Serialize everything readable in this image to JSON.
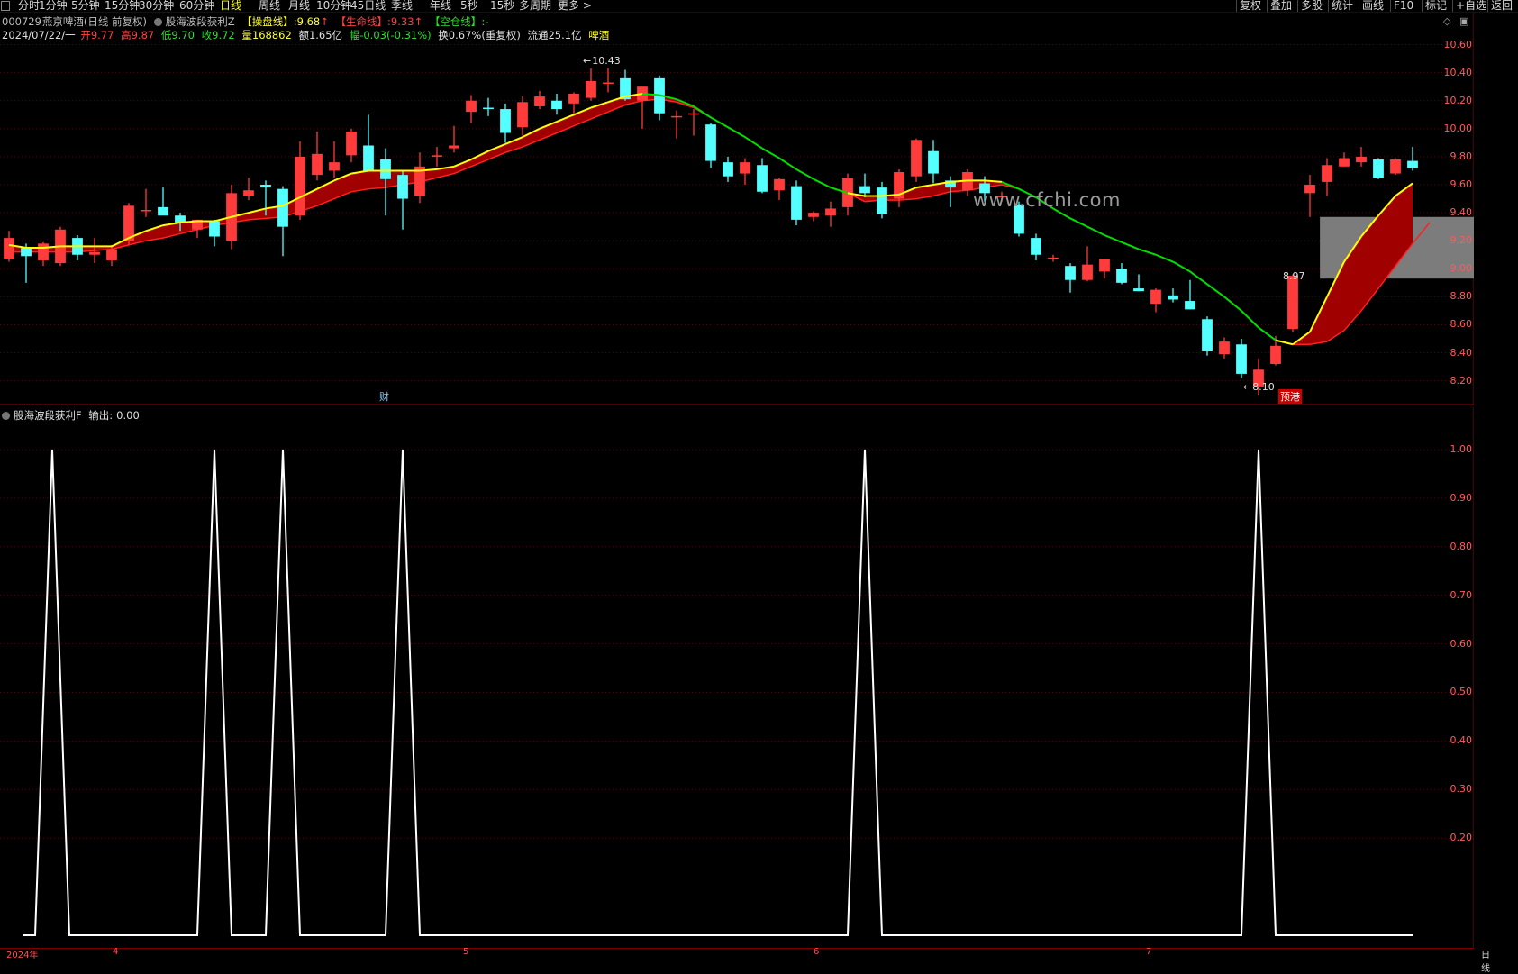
{
  "toolbar": {
    "timeframes": [
      "分时",
      "1分钟",
      "5分钟",
      "15分钟",
      "30分钟",
      "60分钟",
      "日线",
      "周线",
      "月线",
      "10分钟",
      "45日线",
      "季线",
      "年线",
      "5秒",
      "15秒",
      "多周期",
      "更多 >"
    ],
    "active_timeframe": "日线",
    "right_buttons": [
      "复权",
      "叠加",
      "多股",
      "统计",
      "画线",
      "F10",
      "标记",
      "+自选",
      "返回"
    ]
  },
  "main": {
    "stock_code": "000729",
    "stock_name": "燕京啤酒",
    "stock_mode": "(日线 前复权)",
    "indicator_name": "股海波段获利Z",
    "line1_label": "【操盘线】",
    "line1_value": "9.68",
    "line2_label": "【生命线】",
    "line2_value": "9.33",
    "line3_label": "【空仓线】",
    "line3_value": "-",
    "date": "2024/07/22/一",
    "open_label": "开",
    "open": "9.77",
    "high_label": "高",
    "high": "9.87",
    "low_label": "低",
    "low": "9.70",
    "close_label": "收",
    "close": "9.72",
    "vol_label": "量",
    "vol": "168862",
    "amount_label": "额",
    "amount": "1.65亿",
    "chg_label": "幅",
    "chg": "-0.03(-0.31%)",
    "turnover_label": "换",
    "turnover": "0.67%(重复权)",
    "float_label": "流通",
    "float": "25.1亿",
    "sector": "啤酒",
    "max_marker": "10.43",
    "min_marker": "8.10",
    "box_label": "8.97",
    "event_cai": "财",
    "event_yugang": "预港",
    "watermark": "www.cfchi.com",
    "y_ticks": [
      "10.60",
      "10.40",
      "10.20",
      "10.00",
      "9.80",
      "9.60",
      "9.40",
      "9.20",
      "9.00",
      "8.80",
      "8.60",
      "8.40",
      "8.20"
    ]
  },
  "sub": {
    "indicator_name": "股海波段获利F",
    "output_label": "输出:",
    "output_value": "0.00",
    "y_ticks": [
      "1.00",
      "0.90",
      "0.80",
      "0.70",
      "0.60",
      "0.50",
      "0.40",
      "0.30",
      "0.20"
    ]
  },
  "x_axis": {
    "labels": [
      "2024年",
      "4",
      "5",
      "6",
      "7"
    ],
    "right_label": "日线"
  },
  "colors": {
    "up": "#ff3b3b",
    "down": "#54ffff",
    "ma_up": "#ffff00",
    "ma_down": "#00dd00",
    "ribbon": "#a00000",
    "grid": "#5a0000"
  },
  "chart_data": {
    "type": "candlestick",
    "price_ylim": [
      8.05,
      10.7
    ],
    "candles": [
      {
        "o": 9.07,
        "h": 9.27,
        "l": 9.05,
        "c": 9.22
      },
      {
        "o": 9.15,
        "h": 9.18,
        "l": 8.9,
        "c": 9.09
      },
      {
        "o": 9.06,
        "h": 9.19,
        "l": 9.02,
        "c": 9.18
      },
      {
        "o": 9.04,
        "h": 9.3,
        "l": 9.02,
        "c": 9.28
      },
      {
        "o": 9.22,
        "h": 9.24,
        "l": 9.06,
        "c": 9.1
      },
      {
        "o": 9.1,
        "h": 9.22,
        "l": 9.04,
        "c": 9.12
      },
      {
        "o": 9.06,
        "h": 9.17,
        "l": 9.02,
        "c": 9.14
      },
      {
        "o": 9.2,
        "h": 9.47,
        "l": 9.17,
        "c": 9.45
      },
      {
        "o": 9.42,
        "h": 9.57,
        "l": 9.37,
        "c": 9.42
      },
      {
        "o": 9.44,
        "h": 9.58,
        "l": 9.39,
        "c": 9.38
      },
      {
        "o": 9.38,
        "h": 9.4,
        "l": 9.27,
        "c": 9.33
      },
      {
        "o": 9.28,
        "h": 9.35,
        "l": 9.22,
        "c": 9.35
      },
      {
        "o": 9.34,
        "h": 9.35,
        "l": 9.16,
        "c": 9.23
      },
      {
        "o": 9.2,
        "h": 9.6,
        "l": 9.14,
        "c": 9.54
      },
      {
        "o": 9.52,
        "h": 9.65,
        "l": 9.49,
        "c": 9.56
      },
      {
        "o": 9.6,
        "h": 9.63,
        "l": 9.38,
        "c": 9.58
      },
      {
        "o": 9.57,
        "h": 9.59,
        "l": 9.09,
        "c": 9.3
      },
      {
        "o": 9.38,
        "h": 9.91,
        "l": 9.35,
        "c": 9.8
      },
      {
        "o": 9.67,
        "h": 9.98,
        "l": 9.63,
        "c": 9.82
      },
      {
        "o": 9.7,
        "h": 9.91,
        "l": 9.65,
        "c": 9.76
      },
      {
        "o": 9.81,
        "h": 10.0,
        "l": 9.76,
        "c": 9.98
      },
      {
        "o": 9.88,
        "h": 10.1,
        "l": 9.71,
        "c": 9.7
      },
      {
        "o": 9.78,
        "h": 9.86,
        "l": 9.38,
        "c": 9.64
      },
      {
        "o": 9.67,
        "h": 9.7,
        "l": 9.28,
        "c": 9.5
      },
      {
        "o": 9.52,
        "h": 9.83,
        "l": 9.47,
        "c": 9.73
      },
      {
        "o": 9.8,
        "h": 9.87,
        "l": 9.73,
        "c": 9.81
      },
      {
        "o": 9.86,
        "h": 10.02,
        "l": 9.83,
        "c": 9.88
      },
      {
        "o": 10.12,
        "h": 10.24,
        "l": 10.04,
        "c": 10.2
      },
      {
        "o": 10.15,
        "h": 10.22,
        "l": 10.09,
        "c": 10.14
      },
      {
        "o": 10.14,
        "h": 10.18,
        "l": 9.9,
        "c": 9.97
      },
      {
        "o": 10.01,
        "h": 10.23,
        "l": 9.95,
        "c": 10.19
      },
      {
        "o": 10.16,
        "h": 10.27,
        "l": 10.14,
        "c": 10.23
      },
      {
        "o": 10.2,
        "h": 10.25,
        "l": 10.1,
        "c": 10.14
      },
      {
        "o": 10.18,
        "h": 10.26,
        "l": 10.09,
        "c": 10.25
      },
      {
        "o": 10.22,
        "h": 10.43,
        "l": 10.2,
        "c": 10.34
      },
      {
        "o": 10.33,
        "h": 10.43,
        "l": 10.26,
        "c": 10.33
      },
      {
        "o": 10.36,
        "h": 10.42,
        "l": 10.2,
        "c": 10.21
      },
      {
        "o": 10.2,
        "h": 10.3,
        "l": 10.0,
        "c": 10.3
      },
      {
        "o": 10.36,
        "h": 10.38,
        "l": 10.06,
        "c": 10.11
      },
      {
        "o": 10.09,
        "h": 10.13,
        "l": 9.93,
        "c": 10.09
      },
      {
        "o": 10.11,
        "h": 10.14,
        "l": 9.95,
        "c": 10.11
      },
      {
        "o": 10.03,
        "h": 10.04,
        "l": 9.72,
        "c": 9.77
      },
      {
        "o": 9.76,
        "h": 9.8,
        "l": 9.62,
        "c": 9.66
      },
      {
        "o": 9.68,
        "h": 9.79,
        "l": 9.6,
        "c": 9.76
      },
      {
        "o": 9.74,
        "h": 9.79,
        "l": 9.54,
        "c": 9.55
      },
      {
        "o": 9.56,
        "h": 9.65,
        "l": 9.49,
        "c": 9.64
      },
      {
        "o": 9.59,
        "h": 9.63,
        "l": 9.31,
        "c": 9.35
      },
      {
        "o": 9.37,
        "h": 9.41,
        "l": 9.34,
        "c": 9.4
      },
      {
        "o": 9.38,
        "h": 9.48,
        "l": 9.3,
        "c": 9.43
      },
      {
        "o": 9.44,
        "h": 9.68,
        "l": 9.38,
        "c": 9.65
      },
      {
        "o": 9.59,
        "h": 9.68,
        "l": 9.51,
        "c": 9.54
      },
      {
        "o": 9.58,
        "h": 9.62,
        "l": 9.36,
        "c": 9.39
      },
      {
        "o": 9.5,
        "h": 9.71,
        "l": 9.44,
        "c": 9.69
      },
      {
        "o": 9.66,
        "h": 9.93,
        "l": 9.62,
        "c": 9.92
      },
      {
        "o": 9.84,
        "h": 9.92,
        "l": 9.61,
        "c": 9.68
      },
      {
        "o": 9.63,
        "h": 9.66,
        "l": 9.44,
        "c": 9.58
      },
      {
        "o": 9.56,
        "h": 9.71,
        "l": 9.52,
        "c": 9.69
      },
      {
        "o": 9.61,
        "h": 9.66,
        "l": 9.48,
        "c": 9.54
      },
      {
        "o": 9.51,
        "h": 9.55,
        "l": 9.48,
        "c": 9.52
      },
      {
        "o": 9.46,
        "h": 9.48,
        "l": 9.23,
        "c": 9.25
      },
      {
        "o": 9.22,
        "h": 9.25,
        "l": 9.06,
        "c": 9.1
      },
      {
        "o": 9.08,
        "h": 9.1,
        "l": 9.05,
        "c": 9.08
      },
      {
        "o": 9.02,
        "h": 9.04,
        "l": 8.83,
        "c": 8.92
      },
      {
        "o": 8.92,
        "h": 9.16,
        "l": 8.91,
        "c": 9.03
      },
      {
        "o": 8.98,
        "h": 9.06,
        "l": 8.93,
        "c": 9.07
      },
      {
        "o": 9.0,
        "h": 9.04,
        "l": 8.89,
        "c": 8.9
      },
      {
        "o": 8.86,
        "h": 8.96,
        "l": 8.84,
        "c": 8.84
      },
      {
        "o": 8.75,
        "h": 8.86,
        "l": 8.69,
        "c": 8.85
      },
      {
        "o": 8.81,
        "h": 8.86,
        "l": 8.76,
        "c": 8.78
      },
      {
        "o": 8.77,
        "h": 8.92,
        "l": 8.71,
        "c": 8.71
      },
      {
        "o": 8.64,
        "h": 8.66,
        "l": 8.38,
        "c": 8.41
      },
      {
        "o": 8.39,
        "h": 8.51,
        "l": 8.36,
        "c": 8.48
      },
      {
        "o": 8.46,
        "h": 8.5,
        "l": 8.22,
        "c": 8.25
      },
      {
        "o": 8.16,
        "h": 8.36,
        "l": 8.1,
        "c": 8.28
      },
      {
        "o": 8.32,
        "h": 8.52,
        "l": 8.31,
        "c": 8.45
      },
      {
        "o": 8.57,
        "h": 8.96,
        "l": 8.55,
        "c": 8.95
      },
      {
        "o": 9.54,
        "h": 9.67,
        "l": 9.37,
        "c": 9.6
      },
      {
        "o": 9.62,
        "h": 9.79,
        "l": 9.52,
        "c": 9.74
      },
      {
        "o": 9.73,
        "h": 9.83,
        "l": 9.73,
        "c": 9.79
      },
      {
        "o": 9.76,
        "h": 9.87,
        "l": 9.73,
        "c": 9.8
      },
      {
        "o": 9.78,
        "h": 9.79,
        "l": 9.64,
        "c": 9.65
      },
      {
        "o": 9.68,
        "h": 9.79,
        "l": 9.67,
        "c": 9.78
      },
      {
        "o": 9.77,
        "h": 9.87,
        "l": 9.7,
        "c": 9.72
      }
    ],
    "ma_fast": [
      9.17,
      9.15,
      9.15,
      9.16,
      9.16,
      9.16,
      9.16,
      9.22,
      9.27,
      9.31,
      9.33,
      9.34,
      9.34,
      9.37,
      9.4,
      9.43,
      9.45,
      9.51,
      9.57,
      9.63,
      9.68,
      9.7,
      9.7,
      9.7,
      9.7,
      9.71,
      9.73,
      9.78,
      9.84,
      9.89,
      9.94,
      10.0,
      10.05,
      10.1,
      10.15,
      10.19,
      10.23,
      10.25,
      10.24,
      10.21,
      10.16,
      10.08,
      10.01,
      9.94,
      9.86,
      9.79,
      9.71,
      9.64,
      9.58,
      9.54,
      9.52,
      9.52,
      9.53,
      9.58,
      9.6,
      9.62,
      9.63,
      9.63,
      9.62,
      9.57,
      9.51,
      9.43,
      9.36,
      9.3,
      9.24,
      9.19,
      9.14,
      9.1,
      9.05,
      8.98,
      8.89,
      8.8,
      8.7,
      8.58,
      8.49,
      8.46,
      8.55,
      8.8,
      9.05,
      9.23,
      9.38,
      9.52,
      9.61,
      9.68
    ],
    "ma_slow": [
      9.12,
      9.12,
      9.12,
      9.12,
      9.12,
      9.13,
      9.14,
      9.17,
      9.2,
      9.22,
      9.25,
      9.28,
      9.31,
      9.33,
      9.35,
      9.36,
      9.37,
      9.41,
      9.45,
      9.5,
      9.55,
      9.57,
      9.58,
      9.6,
      9.62,
      9.65,
      9.68,
      9.73,
      9.78,
      9.83,
      9.87,
      9.92,
      9.97,
      10.02,
      10.07,
      10.12,
      10.17,
      10.2,
      10.21,
      10.19,
      10.15,
      10.08,
      10.01,
      9.94,
      9.86,
      9.79,
      9.71,
      9.64,
      9.58,
      9.54,
      9.48,
      9.49,
      9.49,
      9.5,
      9.52,
      9.55,
      9.56,
      9.58,
      9.6,
      9.57,
      9.51,
      9.43,
      9.36,
      9.3,
      9.24,
      9.19,
      9.14,
      9.1,
      9.05,
      8.98,
      8.89,
      8.8,
      8.7,
      8.58,
      8.49,
      8.46,
      8.46,
      8.48,
      8.56,
      8.7,
      8.86,
      9.02,
      9.18,
      9.33
    ],
    "ma_trend_up": [
      1,
      1,
      1,
      1,
      1,
      1,
      1,
      1,
      1,
      1,
      1,
      1,
      1,
      1,
      1,
      1,
      1,
      1,
      1,
      1,
      1,
      1,
      1,
      1,
      1,
      1,
      1,
      1,
      1,
      1,
      1,
      1,
      1,
      1,
      1,
      1,
      1,
      1,
      0,
      0,
      0,
      0,
      0,
      0,
      0,
      0,
      0,
      0,
      0,
      0,
      1,
      1,
      1,
      1,
      1,
      1,
      1,
      1,
      1,
      0,
      0,
      0,
      0,
      0,
      0,
      0,
      0,
      0,
      0,
      0,
      0,
      0,
      0,
      0,
      0,
      1,
      1,
      1,
      1,
      1,
      1,
      1,
      1,
      1
    ],
    "signal_box": {
      "top": 9.37,
      "bottom": 8.93
    },
    "sub_signal": {
      "ylim": [
        0,
        1.05
      ],
      "peak_indices": [
        2,
        12,
        16,
        23,
        50,
        73
      ],
      "values_baseline": 0.0,
      "peak_value": 1.0
    }
  }
}
